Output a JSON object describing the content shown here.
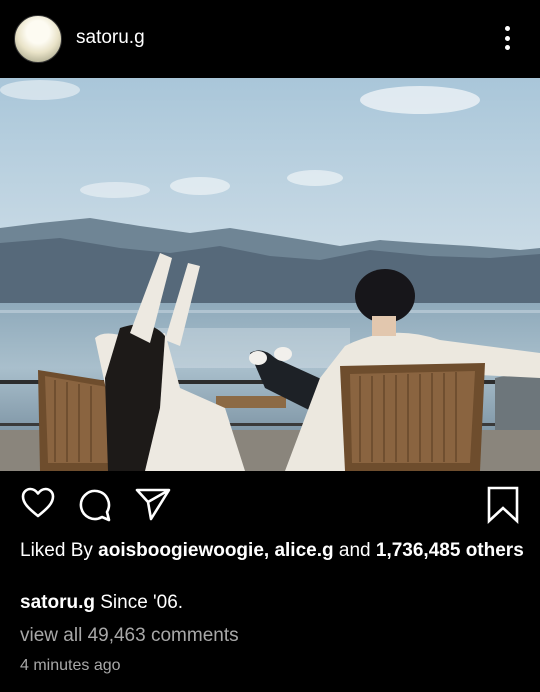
{
  "post": {
    "username": "satoru.g",
    "more_icon": "more-vertical-icon",
    "photo_alt": "",
    "actions": {
      "like_icon": "heart-outline-icon",
      "comment_icon": "comment-bubble-icon",
      "share_icon": "send-paper-plane-icon",
      "save_icon": "bookmark-outline-icon"
    },
    "likes": {
      "prefix": "Liked By",
      "user1": "aoisboogiewoogie,",
      "user2": "alice.g",
      "and": "and",
      "count": "1,736,485",
      "suffix": "others"
    },
    "caption": {
      "username": "satoru.g",
      "text": "Since '06."
    },
    "comments_link": "view all 49,463 comments",
    "timestamp": "4 minutes ago"
  }
}
